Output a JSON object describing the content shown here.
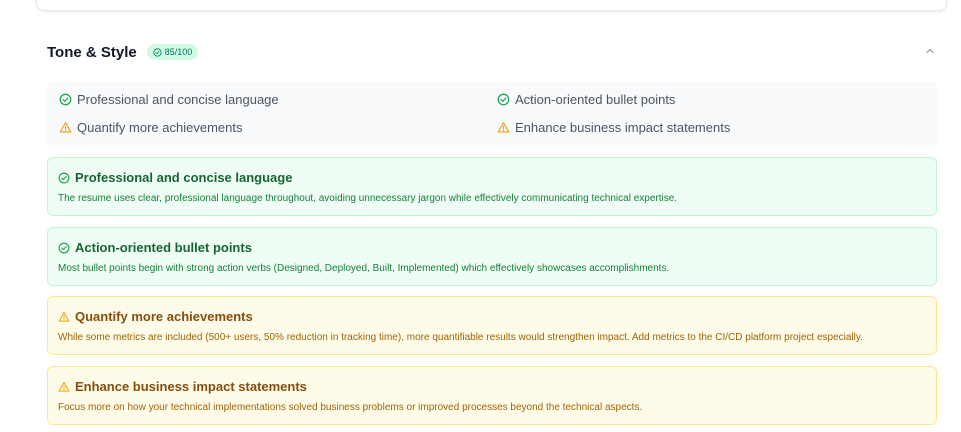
{
  "section": {
    "title": "Tone & Style",
    "score": "85/100"
  },
  "summary": {
    "items": [
      {
        "label": "Professional and concise language",
        "status": "success"
      },
      {
        "label": "Action-oriented bullet points",
        "status": "success"
      },
      {
        "label": "Quantify more achievements",
        "status": "warning"
      },
      {
        "label": "Enhance business impact statements",
        "status": "warning"
      }
    ]
  },
  "details": [
    {
      "title": "Professional and concise language",
      "description": "The resume uses clear, professional language throughout, avoiding unnecessary jargon while effectively communicating technical expertise.",
      "status": "success"
    },
    {
      "title": "Action-oriented bullet points",
      "description": "Most bullet points begin with strong action verbs (Designed, Deployed, Built, Implemented) which effectively showcases accomplishments.",
      "status": "success"
    },
    {
      "title": "Quantify more achievements",
      "description": "While some metrics are included (500+ users, 50% reduction in tracking time), more quantifiable results would strengthen impact. Add metrics to the CI/CD platform project especially.",
      "status": "warning"
    },
    {
      "title": "Enhance business impact statements",
      "description": "Focus more on how your technical implementations solved business problems or improved processes beyond the technical aspects.",
      "status": "warning"
    }
  ],
  "colors": {
    "success": "#16a34a",
    "warning": "#f59e0b"
  },
  "icons": {
    "success": "check-circle-icon",
    "warning": "warning-triangle-icon",
    "collapse": "chevron-up-icon"
  }
}
